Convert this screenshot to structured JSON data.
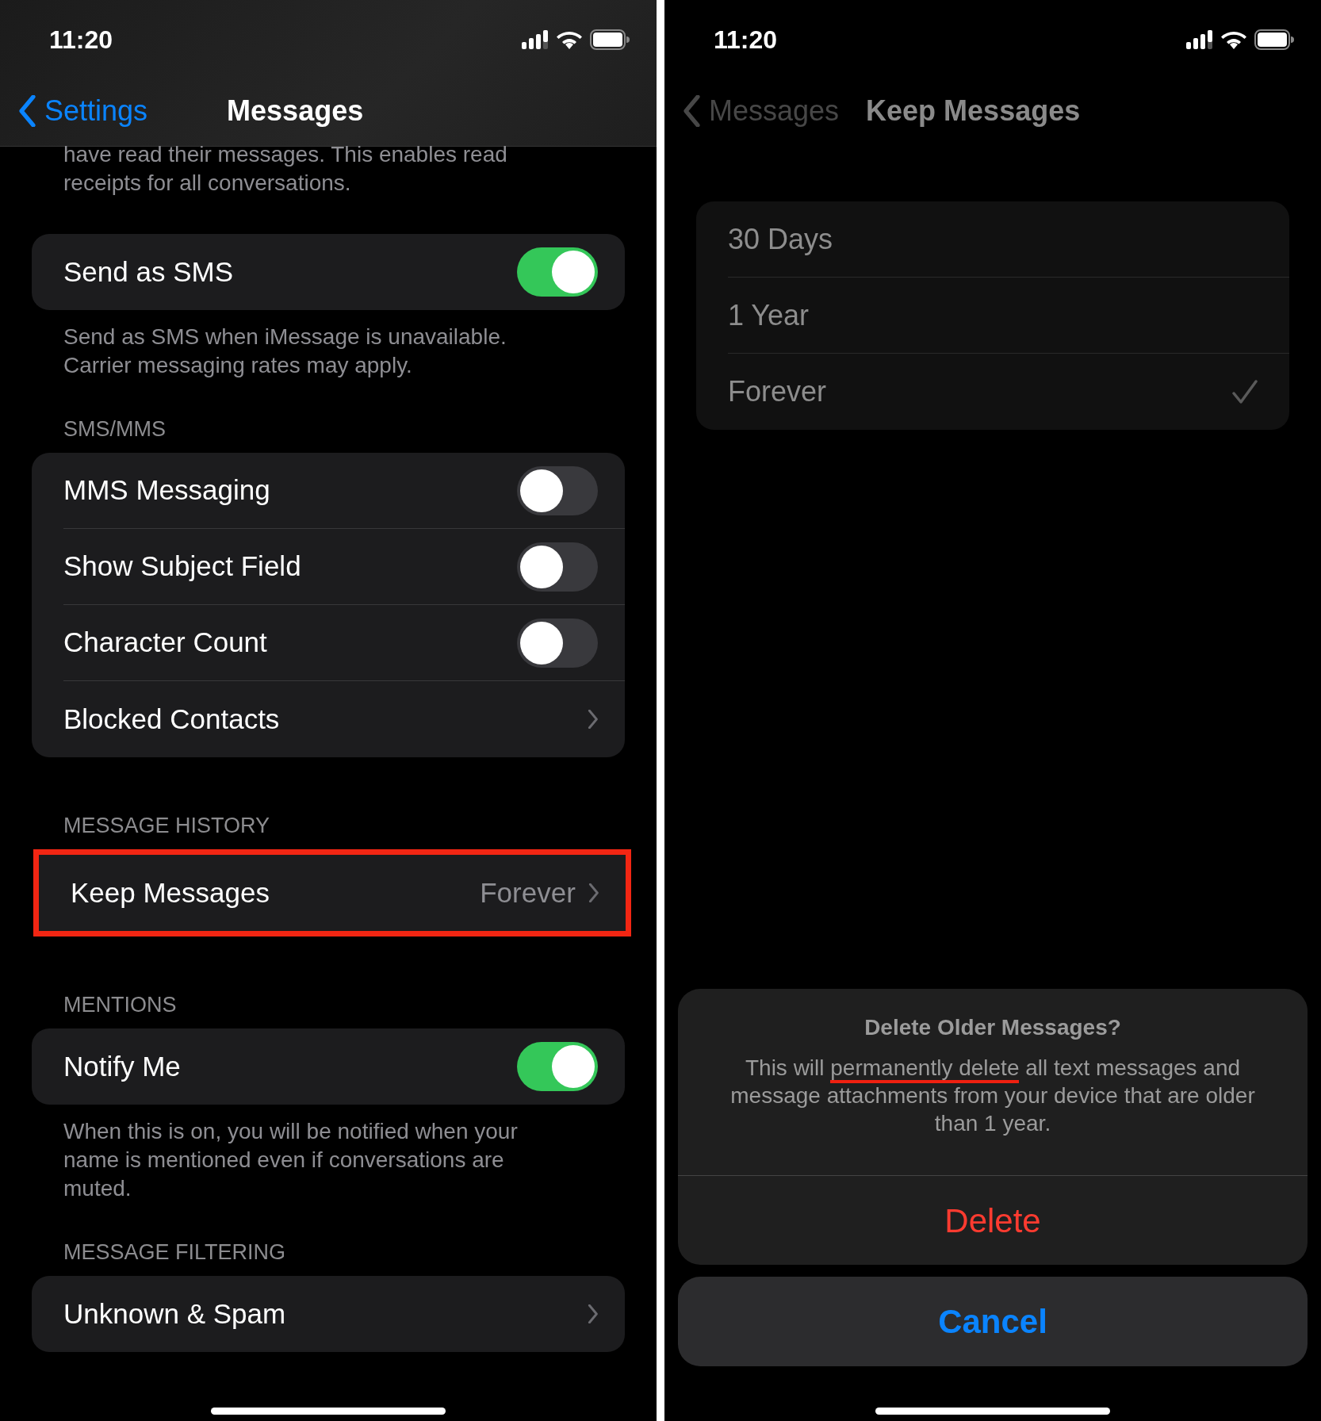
{
  "left_screen": {
    "status_bar": {
      "time": "11:20"
    },
    "nav": {
      "back": "Settings",
      "title": "Messages"
    },
    "sections": [
      {
        "footer": "have read their messages. This enables read receipts for all conversations.",
        "highlighted": false
      },
      {
        "highlighted": false,
        "rows": [
          {
            "kind": "toggle",
            "label": "Send as SMS",
            "on": true
          }
        ],
        "footer": "Send as SMS when iMessage is unavailable. Carrier messaging rates may apply."
      },
      {
        "header": "SMS/MMS",
        "highlighted": false,
        "rows": [
          {
            "kind": "toggle",
            "label": "MMS Messaging",
            "on": false
          },
          {
            "kind": "toggle",
            "label": "Show Subject Field",
            "on": false
          },
          {
            "kind": "toggle",
            "label": "Character Count",
            "on": false
          },
          {
            "kind": "link",
            "label": "Blocked Contacts"
          }
        ]
      },
      {
        "header": "MESSAGE HISTORY",
        "highlighted": true,
        "rows": [
          {
            "kind": "link",
            "label": "Keep Messages",
            "value": "Forever"
          }
        ]
      },
      {
        "header": "MENTIONS",
        "highlighted": false,
        "rows": [
          {
            "kind": "toggle",
            "label": "Notify Me",
            "on": true
          }
        ],
        "footer": "When this is on, you will be notified when your name is mentioned even if conversations are muted."
      },
      {
        "header": "MESSAGE FILTERING",
        "highlighted": false,
        "rows": [
          {
            "kind": "link",
            "label": "Unknown & Spam"
          }
        ]
      }
    ]
  },
  "right_screen": {
    "status_bar": {
      "time": "11:20"
    },
    "nav": {
      "back": "Messages",
      "title": "Keep Messages"
    },
    "options": [
      {
        "label": "30 Days",
        "selected": false
      },
      {
        "label": "1 Year",
        "selected": false
      },
      {
        "label": "Forever",
        "selected": true
      }
    ],
    "alert": {
      "title": "Delete Older Messages?",
      "message_parts": [
        {
          "text": "This will ",
          "underlined": false
        },
        {
          "text": "permanently delete",
          "underlined": true
        },
        {
          "text": " all text messages and message attachments from your device that are older than 1 year.",
          "underlined": false
        }
      ],
      "buttons": [
        {
          "label": "Delete",
          "kind": "destructive"
        }
      ]
    },
    "cancel": {
      "label": "Cancel"
    }
  }
}
